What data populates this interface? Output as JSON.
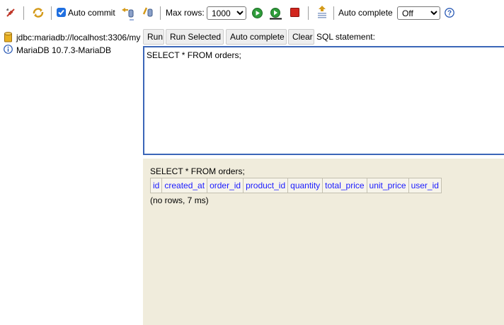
{
  "toolbar": {
    "auto_commit_label": "Auto commit",
    "auto_commit_checked": true,
    "max_rows_label": "Max rows:",
    "max_rows_value": "1000",
    "auto_complete_label": "Auto complete",
    "auto_complete_value": "Off",
    "icons": [
      "disconnect-icon",
      "refresh-icon",
      "commit-icon",
      "rollback-icon",
      "run-icon",
      "run-selected-icon",
      "stop-icon",
      "history-icon",
      "help-icon"
    ]
  },
  "tree": {
    "connection": "jdbc:mariadb://localhost:3306/my",
    "server_info": "MariaDB 10.7.3-MariaDB"
  },
  "query_panel": {
    "buttons": {
      "run": "Run",
      "run_selected": "Run Selected",
      "auto_complete": "Auto complete",
      "clear": "Clear"
    },
    "sql_label": "SQL statement:",
    "sql_text": "SELECT * FROM orders;"
  },
  "results": {
    "statement": "SELECT * FROM orders;",
    "columns": [
      "id",
      "created_at",
      "order_id",
      "product_id",
      "quantity",
      "total_price",
      "unit_price",
      "user_id"
    ],
    "status": "(no rows, 7 ms)"
  },
  "colors": {
    "editor_border": "#3b66b8",
    "results_bg": "#f0ecdc",
    "column_link": "#1a1aff"
  }
}
